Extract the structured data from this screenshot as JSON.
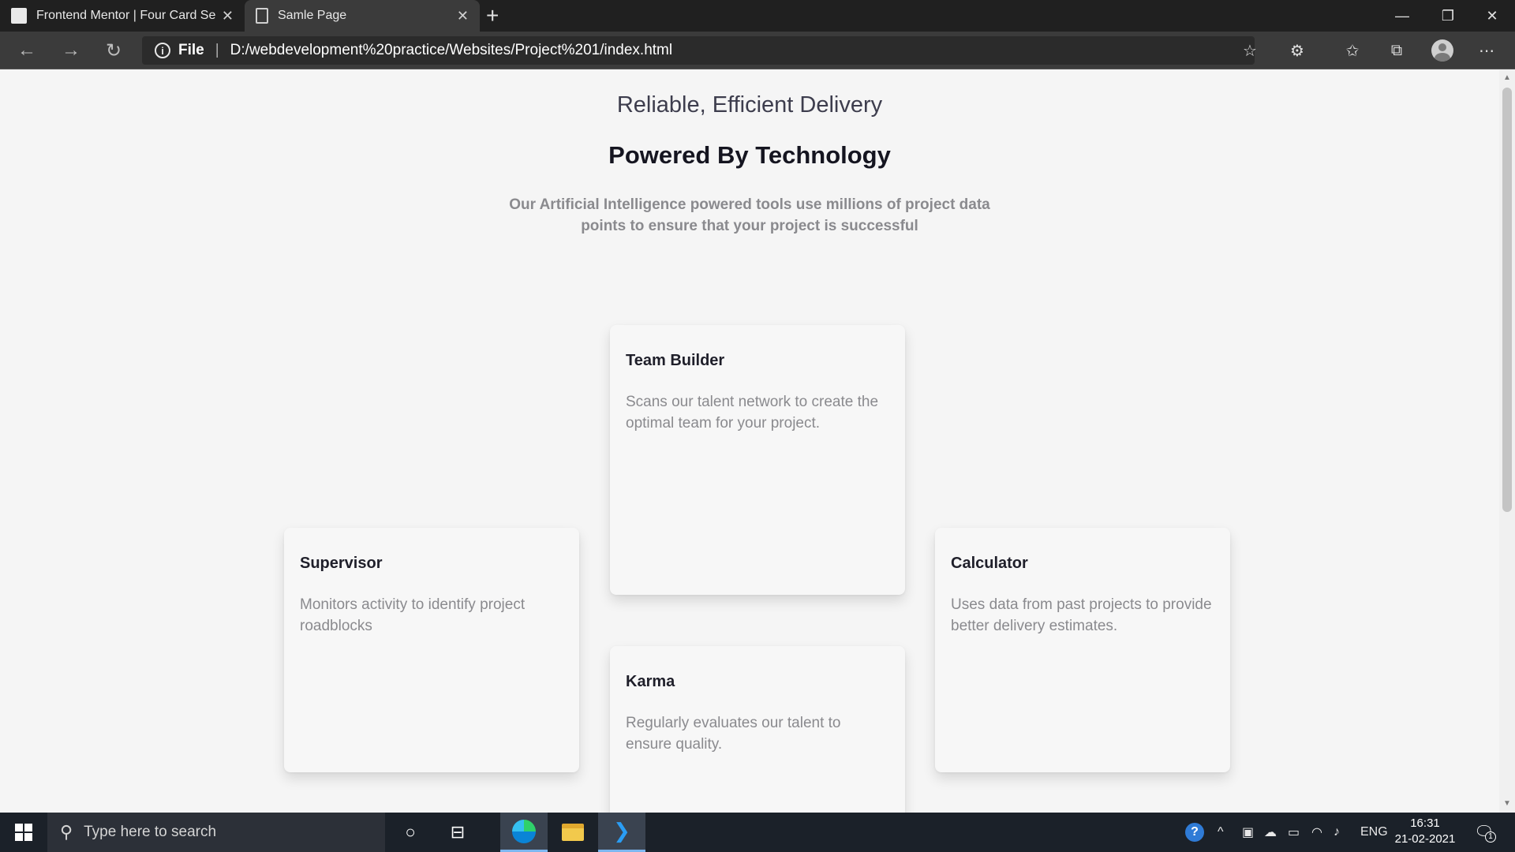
{
  "browser": {
    "tabs": [
      {
        "title": "Frontend Mentor | Four Card Sec",
        "active": false
      },
      {
        "title": "Samle Page",
        "active": true
      }
    ],
    "address": {
      "scheme_label": "File",
      "separator": "|",
      "url": "D:/webdevelopment%20practice/Websites/Project%201/index.html"
    },
    "icons": {
      "back": "arrow-left-icon",
      "forward": "arrow-right-icon",
      "refresh": "refresh-icon",
      "info": "info-icon",
      "add_favorite": "star-plus-icon",
      "extensions": "extension-icon",
      "favorites": "favorites-icon",
      "collections": "collections-icon",
      "profile": "profile-icon",
      "menu": "more-icon"
    }
  },
  "page": {
    "headline_light": "Reliable, Efficient Delivery",
    "headline_bold": "Powered By Technology",
    "description": "Our Artificial Intelligence powered tools use millions of project data points to ensure that your project is successful",
    "cards": {
      "team_builder": {
        "title": "Team Builder",
        "text": "Scans our talent network to create the optimal team for your project."
      },
      "supervisor": {
        "title": "Supervisor",
        "text": "Monitors activity to identify project roadblocks"
      },
      "calculator": {
        "title": "Calculator",
        "text": "Uses data from past projects to provide better delivery estimates."
      },
      "karma": {
        "title": "Karma",
        "text": "Regularly evaluates our talent to ensure quality."
      }
    }
  },
  "taskbar": {
    "search_placeholder": "Type here to search",
    "language": "ENG",
    "time": "16:31",
    "date": "21-02-2021",
    "notification_count": "1",
    "apps": [
      "cortana-icon",
      "task-view-icon",
      "edge-icon",
      "file-explorer-icon",
      "vscode-icon"
    ]
  },
  "colors": {
    "chrome_dark": "#202020",
    "chrome_tab": "#3b3b3b",
    "page_bg": "#f5f5f5",
    "card_bg": "#f7f7f7",
    "taskbar_bg": "#1b2129",
    "muted_text": "#8a8a8e"
  }
}
